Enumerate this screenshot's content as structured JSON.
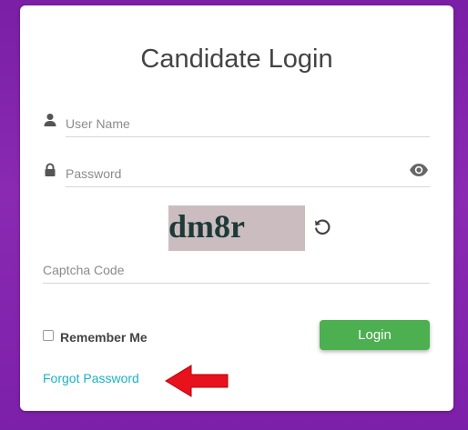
{
  "page": {
    "title": "Candidate Login"
  },
  "form": {
    "username_placeholder": "User Name",
    "password_placeholder": "Password",
    "captcha_placeholder": "Captcha Code",
    "captcha_image_text": "dm8r",
    "remember_label": "Remember Me",
    "remember_checked": false,
    "login_label": "Login",
    "forgot_label": "Forgot Password"
  },
  "icons": {
    "user": "user-icon",
    "lock": "lock-icon",
    "eye": "eye-icon",
    "refresh": "refresh-icon",
    "annotation": "red-arrow"
  },
  "colors": {
    "background": "#7d20a9",
    "login_button": "#4caf50",
    "link": "#1ab3c2",
    "annotation_arrow": "#e8121c",
    "captcha_bg": "#cbbdbf"
  }
}
